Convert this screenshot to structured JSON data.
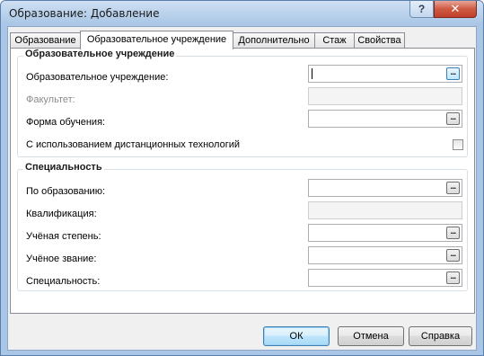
{
  "window": {
    "title": "Образование: Добавление",
    "help_label": "?",
    "close_label": "✕"
  },
  "tabs": [
    {
      "label": "Образование",
      "active": false
    },
    {
      "label": "Образовательное учреждение",
      "active": true
    },
    {
      "label": "Дополнительно",
      "active": false
    },
    {
      "label": "Стаж",
      "active": false
    },
    {
      "label": "Свойства",
      "active": false
    }
  ],
  "institution_group": {
    "title": "Образовательное учреждение",
    "institution_label": "Образовательное учреждение:",
    "institution_value": "",
    "faculty_label": "Факультет:",
    "faculty_value": "",
    "study_form_label": "Форма обучения:",
    "study_form_value": "",
    "distance_label": "С использованием дистанционных технологий",
    "distance_checked": false
  },
  "specialty_group": {
    "title": "Специальность",
    "by_education_label": "По образованию:",
    "qualification_label": "Квалификация:",
    "degree_label": "Учёная степень:",
    "rank_label": "Учёное звание:",
    "specialty_label": "Специальность:"
  },
  "ellipsis_label": "...",
  "buttons": {
    "ok": "ОК",
    "cancel": "Отмена",
    "help": "Справка"
  },
  "colors": {
    "frame": "#aac6e6",
    "close": "#c7452e",
    "default_button": "#3c7fb1"
  }
}
